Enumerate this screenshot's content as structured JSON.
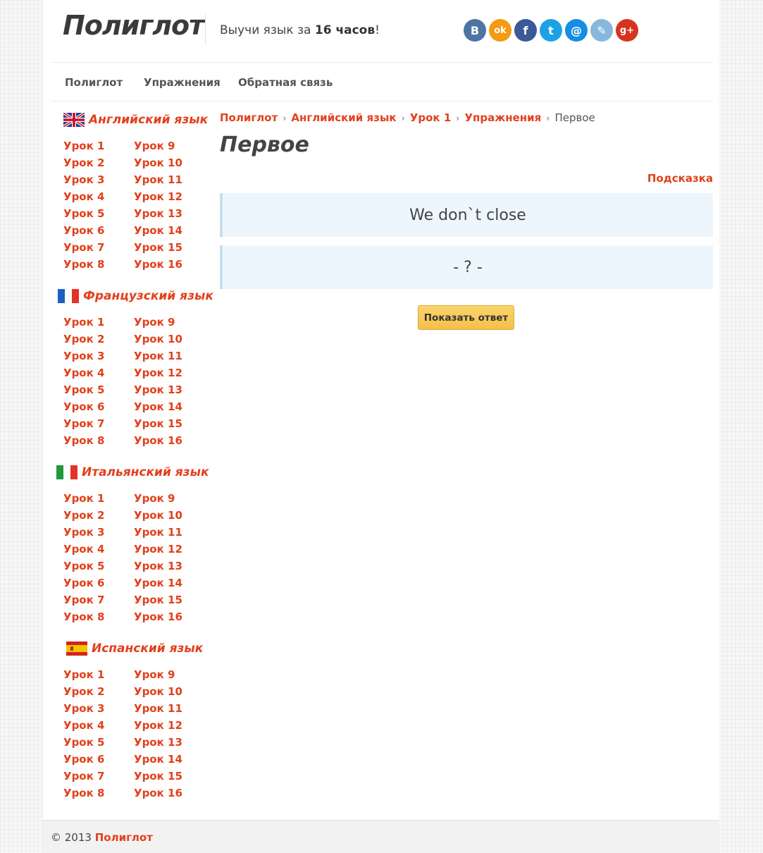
{
  "header": {
    "logo": "Полиглот",
    "tagline_prefix": "Выучи язык за ",
    "tagline_bold": "16 часов",
    "tagline_suffix": "!",
    "social": [
      {
        "icon": "vk-icon",
        "glyph": "В",
        "color": "#4d75a3"
      },
      {
        "icon": "odnoklassniki-icon",
        "glyph": "ok",
        "color": "#f59a13"
      },
      {
        "icon": "facebook-icon",
        "glyph": "f",
        "color": "#3b5998"
      },
      {
        "icon": "twitter-icon",
        "glyph": "t",
        "color": "#1da1e6"
      },
      {
        "icon": "mail-icon",
        "glyph": "@",
        "color": "#168de2"
      },
      {
        "icon": "livejournal-icon",
        "glyph": "✎",
        "color": "#87b8db"
      },
      {
        "icon": "google-plus-icon",
        "glyph": "g+",
        "color": "#d7341f"
      }
    ]
  },
  "nav": {
    "items": [
      "Полиглот",
      "Упражнения",
      "Обратная связь"
    ]
  },
  "sidebar": {
    "languages": [
      {
        "name": "Английский язык",
        "flag": "uk"
      },
      {
        "name": "Французский язык",
        "flag": "fr"
      },
      {
        "name": "Итальянский язык",
        "flag": "it"
      },
      {
        "name": "Испанский язык",
        "flag": "es"
      }
    ],
    "lessons_left": [
      "Урок 1",
      "Урок 2",
      "Урок 3",
      "Урок 4",
      "Урок 5",
      "Урок 6",
      "Урок 7",
      "Урок 8"
    ],
    "lessons_right": [
      "Урок 9",
      "Урок 10",
      "Урок 11",
      "Урок 12",
      "Урок 13",
      "Урок 14",
      "Урок 15",
      "Урок 16"
    ]
  },
  "breadcrumb": {
    "links": [
      "Полиглот",
      "Английский язык",
      "Урок 1",
      "Упражнения"
    ],
    "separator": "›",
    "current": "Первое"
  },
  "main": {
    "title": "Первое",
    "hint": "Подсказка",
    "prompt": "We don`t close",
    "answer_placeholder": "- ? -",
    "show_answer": "Показать ответ"
  },
  "footer": {
    "copyright": "© 2013 ",
    "link": "Полиглот"
  }
}
